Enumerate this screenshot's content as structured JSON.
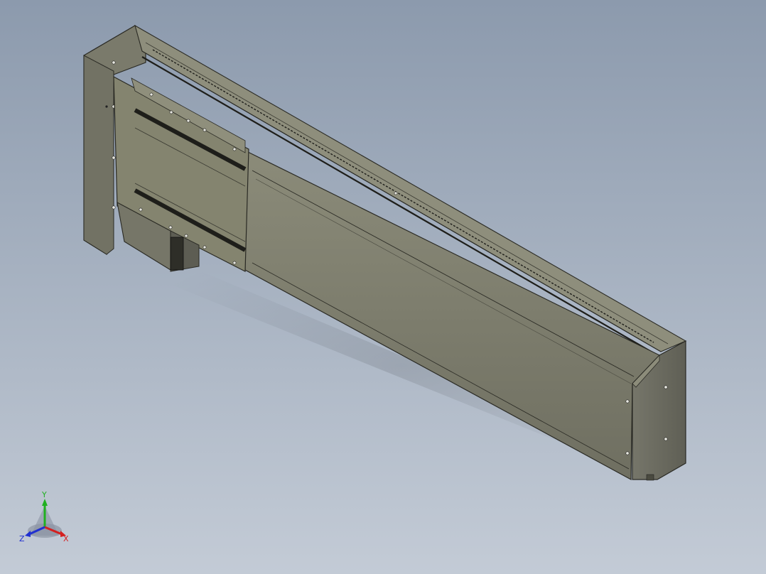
{
  "viewport": {
    "background_top": "#8c9aad",
    "background_bottom": "#c3cbd6"
  },
  "model": {
    "body_color": "#7f7f6e",
    "body_light": "#8a8a78",
    "end_cap_color": "#6e6e62",
    "edge_color": "#2a2a24",
    "slot_color": "#1e1e1a"
  },
  "triad": {
    "x_label": "X",
    "y_label": "Y",
    "z_label": "Z",
    "x_color": "#d42020",
    "y_color": "#20b020",
    "z_color": "#2030d0"
  }
}
